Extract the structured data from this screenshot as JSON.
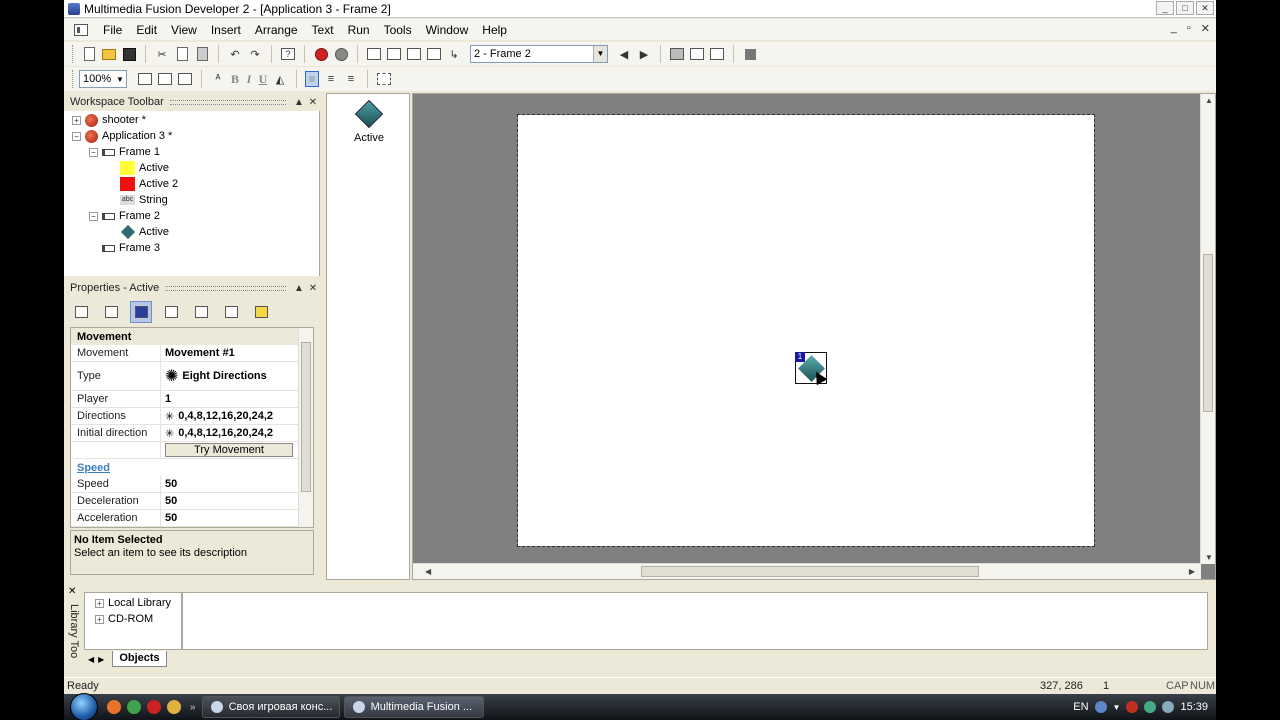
{
  "window": {
    "title": "Multimedia Fusion Developer 2 - [Application 3 - Frame 2]",
    "buttons": [
      "_",
      "□",
      "✕"
    ]
  },
  "menubar": {
    "items": [
      "File",
      "Edit",
      "View",
      "Insert",
      "Arrange",
      "Text",
      "Run",
      "Tools",
      "Window",
      "Help"
    ],
    "mdi_buttons": [
      "_",
      "▫",
      "✕"
    ]
  },
  "toolbar": {
    "frame_select": "2 - Frame 2",
    "zoom": "100%"
  },
  "workspace": {
    "title": "Workspace Toolbar",
    "tree": [
      {
        "label": "shooter *",
        "kind": "app",
        "expander": "+"
      },
      {
        "label": "Application 3 *",
        "kind": "app",
        "expander": "−"
      },
      {
        "label": "Frame 1",
        "kind": "frame",
        "expander": "−"
      },
      {
        "label": "Active",
        "kind": "yellow"
      },
      {
        "label": "Active 2",
        "kind": "red"
      },
      {
        "label": "String",
        "kind": "string"
      },
      {
        "label": "Frame 2",
        "kind": "frame",
        "expander": "−"
      },
      {
        "label": "Active",
        "kind": "diamond"
      },
      {
        "label": "Frame 3",
        "kind": "frame"
      }
    ],
    "string_icon": "abc"
  },
  "properties": {
    "title": "Properties - Active",
    "category1": "Movement",
    "rows": {
      "movement": {
        "name": "Movement",
        "value": "Movement #1"
      },
      "type": {
        "name": "Type",
        "value": "Eight Directions"
      },
      "player": {
        "name": "Player",
        "value": "1"
      },
      "directions": {
        "name": "Directions",
        "value": "0,4,8,12,16,20,24,2"
      },
      "initial": {
        "name": "Initial direction",
        "value": "0,4,8,12,16,20,24,2"
      },
      "try_button": "Try Movement"
    },
    "category2": "Speed",
    "rows2": {
      "speed": {
        "name": "Speed",
        "value": "50"
      },
      "decel": {
        "name": "Deceleration",
        "value": "50"
      },
      "accel": {
        "name": "Acceleration",
        "value": "50"
      }
    },
    "desc_title": "No Item Selected",
    "desc_text": "Select an item to see its description"
  },
  "objectbar": {
    "item_label": "Active"
  },
  "editor": {
    "sprite_number": "1"
  },
  "library": {
    "title": "Library Too",
    "tree": [
      "Local Library",
      "CD-ROM"
    ],
    "tab": "Objects"
  },
  "status": {
    "ready": "Ready",
    "coords": "327, 286",
    "frame": "1",
    "caps": "CAP",
    "num": "NUM"
  },
  "taskbar": {
    "buttons": [
      "Своя игровая конс...",
      "Multimedia Fusion ..."
    ],
    "lang": "EN",
    "clock": "15:39"
  }
}
